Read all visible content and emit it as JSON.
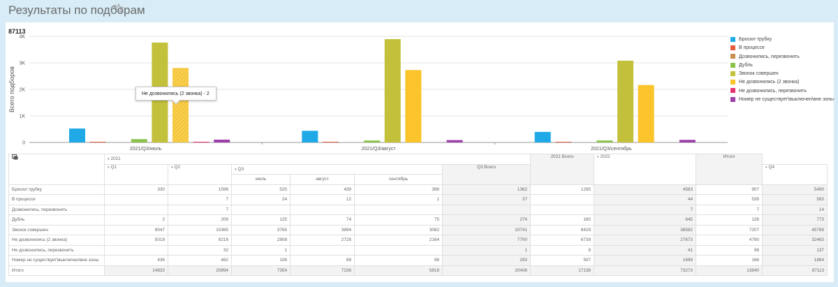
{
  "page": {
    "title": "Результаты по подборам"
  },
  "summary": {
    "total": "87113"
  },
  "colors": {
    "series": [
      "#1fa9e6",
      "#e55b3c",
      "#c98f4e",
      "#8bc34a",
      "#c3c13c",
      "#fbc42a",
      "#e7336f",
      "#9c3fa9"
    ],
    "bar_hatch": "#f5c842"
  },
  "tooltip": {
    "text": "Не дозвонились (2 звонка) - 2"
  },
  "chart_data": {
    "type": "bar",
    "ylabel": "Всего подборов",
    "yticks": [
      "0",
      "1K",
      "2K",
      "3K",
      "4K"
    ],
    "ylim": [
      0,
      4000
    ],
    "categories": [
      "2021/Q3/июль",
      "2021/Q3/август",
      "2021/Q3/сентябрь"
    ],
    "series": [
      {
        "name": "Бросил трубку",
        "values": [
          525,
          439,
          398
        ]
      },
      {
        "name": "В процессе",
        "values": [
          24,
          12,
          1
        ]
      },
      {
        "name": "Дозвонились, перезвонить",
        "values": [
          0,
          0,
          0
        ]
      },
      {
        "name": "Дубль",
        "values": [
          125,
          74,
          75
        ]
      },
      {
        "name": "Звонок совершен",
        "values": [
          3765,
          3894,
          3082
        ]
      },
      {
        "name": "Не дозвонились (2 звонка)",
        "values": [
          2808,
          2728,
          2164
        ]
      },
      {
        "name": "Не дозвонились, перезвонить",
        "values": [
          1,
          0,
          0
        ]
      },
      {
        "name": "Номер не существует\\выключен\\вне зоны",
        "values": [
          106,
          89,
          98
        ]
      }
    ],
    "legend": "right",
    "grid": true
  },
  "table": {
    "header": {
      "y2021": "2021",
      "q1": "Q1",
      "q2": "Q2",
      "q3": "Q3",
      "q3total": "Q3 Всего",
      "q4": "Q4",
      "m1": "июль",
      "m2": "август",
      "m3": "сентябрь",
      "t2021": "2021 Всего",
      "y2022": "2022",
      "total": "Итого"
    },
    "rows": [
      {
        "label": "Бросил трубку",
        "values": [
          "330",
          "1596",
          "525",
          "439",
          "398",
          "1362",
          "1295",
          "4583",
          "907",
          "5490"
        ]
      },
      {
        "label": "В процессе",
        "values": [
          "",
          "7",
          "24",
          "12",
          "1",
          "37",
          "",
          "44",
          "539",
          "583"
        ]
      },
      {
        "label": "Дозвонились, перезвонить",
        "values": [
          "",
          "7",
          "",
          "",
          "",
          "",
          "",
          "7",
          "7",
          "14"
        ]
      },
      {
        "label": "Дубль",
        "values": [
          "2",
          "209",
          "125",
          "74",
          "75",
          "274",
          "160",
          "645",
          "128",
          "773"
        ]
      },
      {
        "label": "Звонок совершен",
        "values": [
          "9047",
          "10365",
          "3765",
          "3894",
          "3082",
          "10741",
          "8429",
          "38582",
          "7207",
          "45789"
        ]
      },
      {
        "label": "Не дозвонились (2 звонка)",
        "values": [
          "5018",
          "8216",
          "2808",
          "2728",
          "2164",
          "7700",
          "6739",
          "27673",
          "4790",
          "32463"
        ]
      },
      {
        "label": "Не дозвонились, перезвонить",
        "values": [
          "",
          "32",
          "1",
          "",
          "",
          "1",
          "8",
          "41",
          "96",
          "137"
        ]
      },
      {
        "label": "Номер не существует\\выключен\\вне зоны",
        "values": [
          "436",
          "462",
          "106",
          "89",
          "98",
          "293",
          "507",
          "1698",
          "166",
          "1864"
        ]
      },
      {
        "label": "Итого",
        "values": [
          "14833",
          "20894",
          "7354",
          "7236",
          "5818",
          "20408",
          "17138",
          "73273",
          "13840",
          "87113"
        ]
      }
    ]
  }
}
